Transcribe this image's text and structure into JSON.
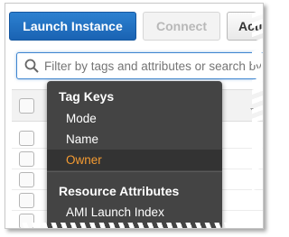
{
  "toolbar": {
    "launch_label": "Launch Instance",
    "connect_label": "Connect",
    "actions_label": "Actions"
  },
  "search": {
    "placeholder": "Filter by tags and attributes or search by keyword"
  },
  "dropdown": {
    "group1_heading": "Tag Keys",
    "group1_items": [
      "Mode",
      "Name",
      "Owner"
    ],
    "selected_item": "Owner",
    "group2_heading": "Resource Attributes",
    "group2_items": [
      "AMI Launch Index"
    ]
  },
  "colors": {
    "primary": "#1a63b3",
    "highlight": "#f49b32",
    "menu_bg": "#444444"
  }
}
